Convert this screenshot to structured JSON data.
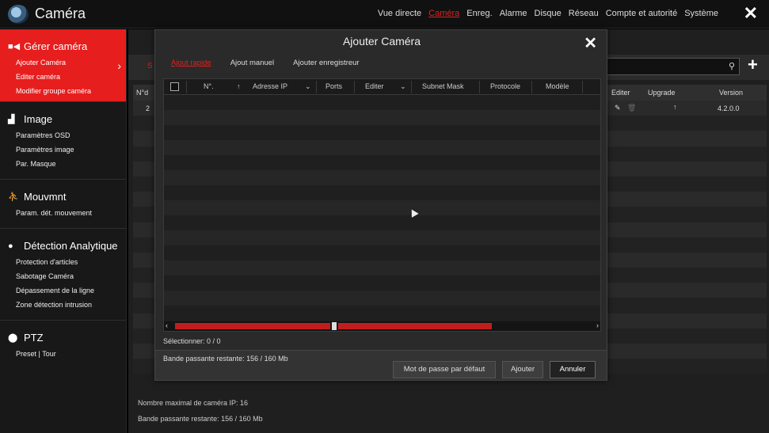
{
  "app": {
    "title": "Caméra",
    "close_icon": "close-icon"
  },
  "topnav": [
    "Vue directe",
    "Caméra",
    "Enreg.",
    "Alarme",
    "Disque",
    "Réseau",
    "Compte et autorité",
    "Système"
  ],
  "topnav_active": "Caméra",
  "sidebar": {
    "sections": [
      {
        "title": "Gérer caméra",
        "icon": "camera-icon",
        "items": [
          "Ajouter Caméra",
          "Editer caméra",
          "Modifier groupe caméra"
        ],
        "active": true
      },
      {
        "title": "Image",
        "icon": "image-icon",
        "items": [
          "Paramètres OSD",
          "Paramètres image",
          "Par. Masque"
        ]
      },
      {
        "title": "Mouvmnt",
        "icon": "running-person-icon",
        "items": [
          "Param. dét. mouvement"
        ]
      },
      {
        "title": "Détection Analytique",
        "icon": "head-icon",
        "items": [
          "Protection d'articles",
          "Sabotage Caméra",
          "Dépassement de la ligne",
          "Zone détection intrusion"
        ]
      },
      {
        "title": "PTZ",
        "icon": "ptz-icon",
        "items": [
          "Preset | Tour"
        ]
      }
    ]
  },
  "background": {
    "tab_fragment": "S",
    "columns": {
      "no": "N°d",
      "edit": "Editer",
      "upgrade": "Upgrade",
      "version": "Version"
    },
    "first_row": {
      "no": "2",
      "version": "4.2.0.0"
    },
    "footer": {
      "max_ip": "Nombre maximal de caméra IP: 16",
      "bandwidth": "Bande passante restante: 156 / 160 Mb"
    }
  },
  "modal": {
    "title": "Ajouter Caméra",
    "tabs": [
      "Ajout rapide",
      "Ajout manuel",
      "Ajouter enregistreur"
    ],
    "active_tab": "Ajout rapide",
    "columns": [
      "N°.",
      "Adresse IP",
      "Ports",
      "Editer",
      "Subnet Mask",
      "Protocole",
      "Modèle"
    ],
    "selected_text": "Sélectionner: 0 / 0",
    "bandwidth_text": "Bande passante restante: 156 / 160 Mb",
    "buttons": {
      "default_password": "Mot de passe par défaut",
      "add": "Ajouter",
      "cancel": "Annuler"
    }
  },
  "colors": {
    "accent": "#e61e1e",
    "background": "#1f1f1f",
    "modal": "#2a2a2a"
  }
}
